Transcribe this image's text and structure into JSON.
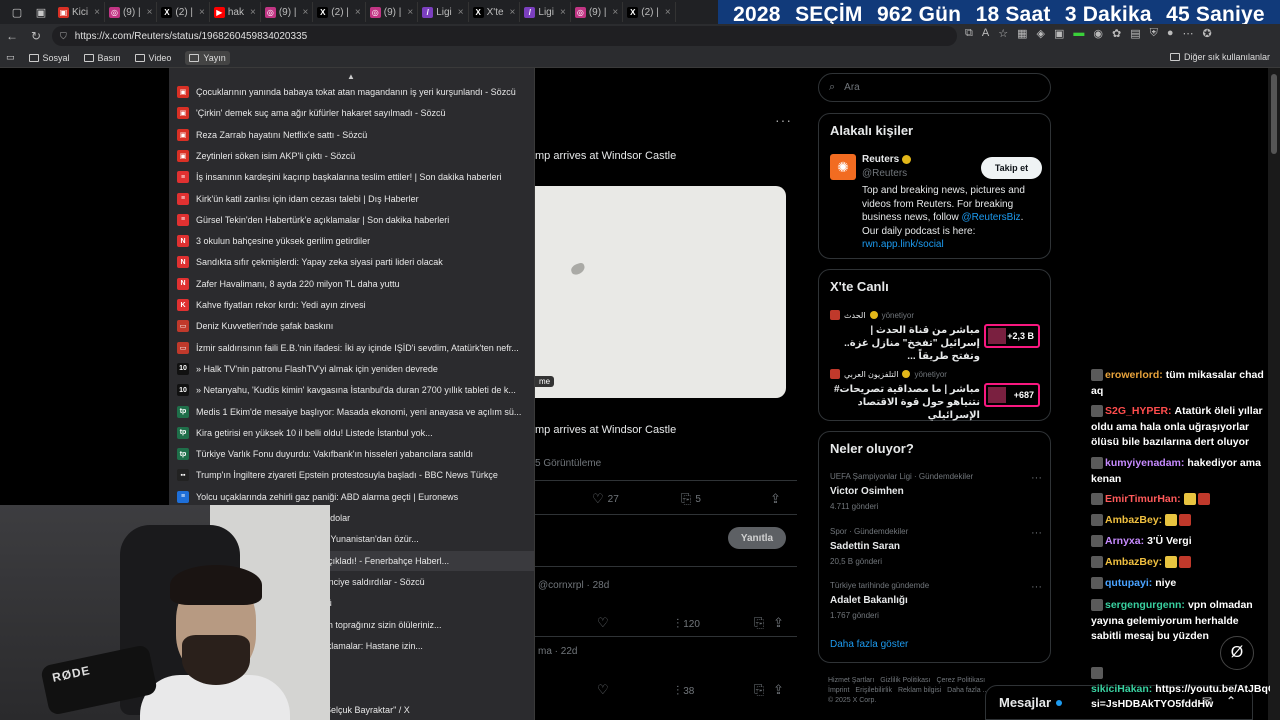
{
  "tabs": [
    {
      "label": "Kici",
      "fav": "▣",
      "color": "#d93025"
    },
    {
      "label": "(9) |",
      "fav": "◎",
      "color": "#c13584"
    },
    {
      "label": "(2) |",
      "fav": "X",
      "color": "#000000"
    },
    {
      "label": "hak",
      "fav": "▶",
      "color": "#ff0000"
    },
    {
      "label": "(9) |",
      "fav": "◎",
      "color": "#c13584"
    },
    {
      "label": "(2) |",
      "fav": "X",
      "color": "#000000"
    },
    {
      "label": "(9) |",
      "fav": "◎",
      "color": "#c13584"
    },
    {
      "label": "Ligi",
      "fav": "/",
      "color": "#7b3fbf"
    },
    {
      "label": "X'te",
      "fav": "X",
      "color": "#000000"
    },
    {
      "label": "Ligi",
      "fav": "/",
      "color": "#7b3fbf"
    },
    {
      "label": "(9) |",
      "fav": "◎",
      "color": "#c13584"
    },
    {
      "label": "(2) |",
      "fav": "X",
      "color": "#000000"
    }
  ],
  "countdown": {
    "year": "2028",
    "label": "SEÇİM",
    "days": "962 Gün",
    "hours": "18 Saat",
    "minutes": "3 Dakika",
    "seconds": "45 Saniye"
  },
  "address": {
    "url": "https://x.com/Reuters/status/1968260459834020335"
  },
  "bookmarks": {
    "items": [
      "Sosyal",
      "Basın",
      "Video",
      "Yayın"
    ],
    "other": "Diğer sık kullanılanlar"
  },
  "dropdown": {
    "items": [
      {
        "text": "Çocuklarının yanında babaya tokat atan magandanın iş yeri kurşunlandı - Sözcü",
        "fav": "▣",
        "color": "#d93025"
      },
      {
        "text": "'Çirkin' demek suç ama ağır küfürler hakaret sayılmadı - Sözcü",
        "fav": "▣",
        "color": "#d93025"
      },
      {
        "text": "Reza Zarrab hayatını Netflix'e sattı - Sözcü",
        "fav": "▣",
        "color": "#d93025"
      },
      {
        "text": "Zeytinleri söken isim AKP'li çıktı - Sözcü",
        "fav": "▣",
        "color": "#d93025"
      },
      {
        "text": "İş insanının kardeşini kaçırıp başkalarına teslim ettiler! | Son dakika haberleri",
        "fav": "≡",
        "color": "#e03131"
      },
      {
        "text": "Kirk'ün katil zanlısı için idam cezası talebi | Dış Haberler",
        "fav": "≡",
        "color": "#e03131"
      },
      {
        "text": "Gürsel Tekin'den Habertürk'e açıklamalar | Son dakika haberleri",
        "fav": "≡",
        "color": "#e03131"
      },
      {
        "text": "3 okulun bahçesine yüksek gerilim getirdiler",
        "fav": "N",
        "color": "#e03131"
      },
      {
        "text": "Sandıkta sıfır çekmişlerdi: Yapay zeka siyasi parti lideri olacak",
        "fav": "N",
        "color": "#e03131"
      },
      {
        "text": "Zafer Havalimanı, 8 ayda 220 milyon TL daha yuttu",
        "fav": "N",
        "color": "#e03131"
      },
      {
        "text": "Kahve fiyatları rekor kırdı: Yedi ayın zirvesi",
        "fav": "K",
        "color": "#e03131"
      },
      {
        "text": "Deniz Kuvvetleri'nde şafak baskını",
        "fav": "▭",
        "color": "#c0392b"
      },
      {
        "text": "İzmir saldırısının faili E.B.'nin ifadesi: İki ay içinde IŞİD'i sevdim, Atatürk'ten nefr...",
        "fav": "▭",
        "color": "#c0392b"
      },
      {
        "text": "» Halk TV'nin patronu FlashTV'yi almak için yeniden devrede",
        "fav": "10",
        "color": "#111111"
      },
      {
        "text": "» Netanyahu, 'Kudüs kimin' kavgasına İstanbul'da duran 2700 yıllık tableti de k...",
        "fav": "10",
        "color": "#111111"
      },
      {
        "text": "Medis 1 Ekim'de mesaiye başlıyor: Masada ekonomi, yeni anayasa ve açılım sü...",
        "fav": "tp",
        "color": "#1f6f4a"
      },
      {
        "text": "Kira getirisi en yüksek 10 il belli oldu! Listede İstanbul yok...",
        "fav": "tp",
        "color": "#1f6f4a"
      },
      {
        "text": "Türkiye Varlık Fonu duyurdu: Vakıfbank'ın hisseleri yabancılara satıldı",
        "fav": "tp",
        "color": "#1f6f4a"
      },
      {
        "text": "Trump'ın İngiltere ziyareti Epstein protestosuyla başladı - BBC News Türkçe",
        "fav": "▪▪",
        "color": "#222222"
      },
      {
        "text": "Yolcu uçaklarında zehirli gaz paniği: ABD alarma geçti | Euronews",
        "fav": "≡",
        "color": "#1e6fd9"
      },
      {
        "text": "Dünyanın en zengin... 500 milyar dolar",
        "fav": "≡",
        "color": "#1e6fd9"
      },
      {
        "text": "Yunan... den, Alperen Şengün de Yunanistan'dan özür...",
        "fav": "≡",
        "color": "#1e6fd9"
      },
      {
        "text": "Fenerbahçe... çekilme sebebini açıkladı! - Fenerbahçe Haberl...",
        "fav": "≡",
        "color": "#1e6fd9"
      },
      {
        "text": "İstanbul... niden hortladı! Bir öğrenciye saldırdılar - Sözcü",
        "fav": "▣",
        "color": "#d93025"
      },
      {
        "text": "Ankara... 'de şekil buluyor - Sözcü",
        "fav": "▣",
        "color": "#d93025"
      },
      {
        "text": "Netanyahu... afının Türkçesi: Sizin toprağınız sizin ölüleriniz...",
        "fav": "≡",
        "color": "#1e6fd9"
      },
      {
        "text": "Sağlık... kan'ın abisinden flaş açıklamalar: Hastane izin...",
        "fav": "≡",
        "color": "#1e6fd9"
      },
      {
        "text": "",
        "fav": "",
        "color": "#2b2b2e"
      },
      {
        "text": "Belediye... başkanı tutuklu",
        "fav": "≡",
        "color": "#1e6fd9"
      },
      {
        "text": "Teknofest... r girişim teşekkürler Selçuk Bayraktar\" / X",
        "fav": "X",
        "color": "#000000"
      }
    ]
  },
  "post": {
    "video_title": "mp arrives at Windsor Castle",
    "video_caption": "mp arrives at Windsor Castle",
    "video_badge": "me",
    "views": "5 Görüntüleme",
    "likes": "27",
    "bookmarks": "5",
    "reply_label": "Yanıtla",
    "reply1_handle": "@cornxrpl · 28d",
    "reply1_stats": "120",
    "reply2_time": "ma · 22d",
    "reply2_stats": "38"
  },
  "sidebar": {
    "search_placeholder": "Ara",
    "related": {
      "title": "Alakalı kişiler",
      "name": "Reuters",
      "handle": "@Reuters",
      "follow_label": "Takip et",
      "bio_1": "Top and breaking news, pictures and videos from Reuters. For breaking business news, follow ",
      "bio_link": "@ReutersBiz",
      "bio_2": ". Our daily podcast is here: ",
      "bio_url": "rwn.app.link/social"
    },
    "live": {
      "title": "X'te Canlı",
      "items": [
        {
          "host": "الحدث",
          "role": "yönetiyor",
          "text": "مباشر من قناة الحدث | إسرائيل \"تفخخ\" منازل غزة.. وتفتح طريقاً ...",
          "count": "+2,3 B"
        },
        {
          "host": "التلفزيون العربي",
          "role": "yönetiyor",
          "text": "مباشر | ما مصداقية تصريحات# نتنياهو حول قوة الاقتصاد الإسرائيلي",
          "count": "+687"
        }
      ]
    },
    "trends": {
      "title": "Neler oluyor?",
      "items": [
        {
          "context": "UEFA Şampiyonlar Ligi · Gündemdekiler",
          "title": "Victor Osimhen",
          "count": "4.711 gönderi"
        },
        {
          "context": "Spor · Gündemdekiler",
          "title": "Sadettin Saran",
          "count": "20,5 B gönderi"
        },
        {
          "context": "Türkiye tarihinde gündemde",
          "title": "Adalet Bakanlığı",
          "count": "1.767 gönderi"
        }
      ],
      "more": "Daha fazla göster"
    },
    "footer": [
      "Hizmet Şartları",
      "Gizlilik Politikası",
      "Çerez Politikası",
      "İmprint",
      "Erişilebilirlik",
      "Reklam bilgisi",
      "Daha fazla ...",
      "© 2025 X Corp."
    ],
    "messages": "Mesajlar"
  },
  "chat": {
    "messages": [
      {
        "user": "erowerlord:",
        "color": "#e8a33c",
        "text": "tüm mikasalar chad aq"
      },
      {
        "user": "S2G_HYPER:",
        "color": "#ff4d4d",
        "text": "Atatürk öleli yıllar oldu ama hala onla uğraşıyorlar ölüsü bile bazılarına dert oluyor"
      },
      {
        "user": "kumyiyenadam:",
        "color": "#c78bff",
        "text": "hakediyor ama kenan"
      },
      {
        "user": "EmirTimurHan:",
        "color": "#ff5a5a",
        "text": ""
      },
      {
        "user": "AmbazBey:",
        "color": "#f0c040",
        "text": ""
      },
      {
        "user": "Arnyxa:",
        "color": "#c78bff",
        "text": "3'Ü Vergi"
      },
      {
        "user": "AmbazBey:",
        "color": "#f0c040",
        "text": ""
      },
      {
        "user": "qutupayi:",
        "color": "#4aa3ff",
        "text": "niye"
      },
      {
        "user": "sergengurgenn:",
        "color": "#39d0a0",
        "text": "vpn olmadan yayına gelemiyorum herhalde sabitli mesaj bu yüzden"
      },
      {
        "user": "sikiciHakan:",
        "color": "#39d0a0",
        "text": "https://youtu.be/AtJBqCVUgN8?si=JsHDBAkTYO5fddHw"
      }
    ]
  }
}
